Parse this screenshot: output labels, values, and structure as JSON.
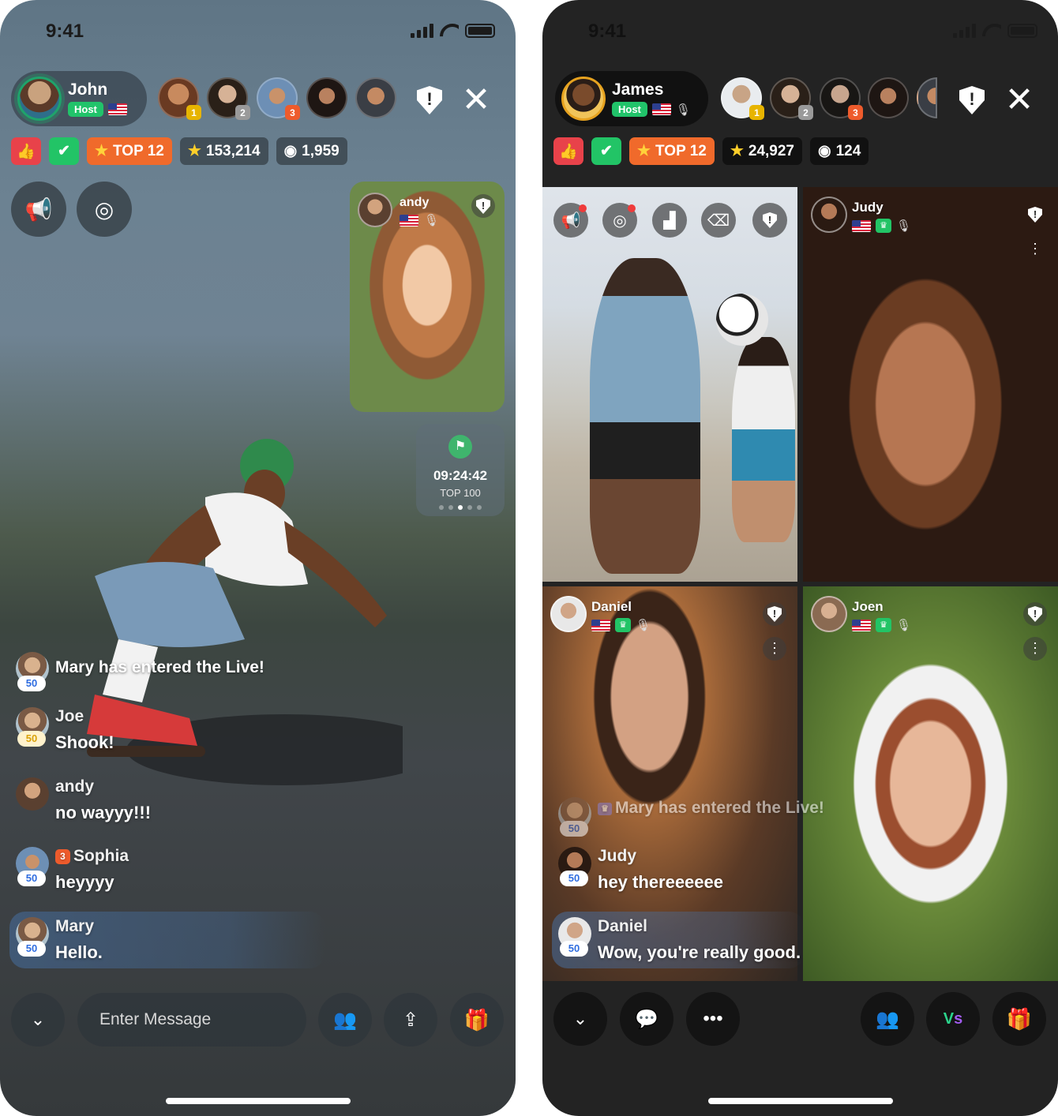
{
  "left": {
    "status": {
      "time": "9:41"
    },
    "host": {
      "name": "John",
      "badge": "Host"
    },
    "viewers": [
      {
        "rank": "1",
        "rank_class": "r1"
      },
      {
        "rank": "2",
        "rank_class": "r2"
      },
      {
        "rank": "3",
        "rank_class": "r3"
      },
      {
        "rank": ""
      },
      {
        "rank": ""
      }
    ],
    "stats": {
      "top": "TOP 12",
      "stars": "153,214",
      "views": "1,959"
    },
    "pip": {
      "name": "andy"
    },
    "timer": {
      "time": "09:24:42",
      "label": "TOP 100"
    },
    "chat": [
      {
        "name": "",
        "level": "50",
        "text": "Mary has entered the Live!"
      },
      {
        "name": "Joe",
        "level": "50",
        "text": "Shook!"
      },
      {
        "name": "andy",
        "level": "",
        "text": "no wayyy!!!"
      },
      {
        "name": "Sophia",
        "level": "50",
        "rank": "3",
        "text": "heyyyy"
      },
      {
        "name": "Mary",
        "level": "50",
        "text": "Hello."
      }
    ],
    "input": {
      "placeholder": "Enter Message"
    },
    "icons": [
      "thumbs-up-icon",
      "check-icon",
      "star-icon",
      "eye-icon",
      "megaphone-icon",
      "target-icon",
      "chevron-down-icon",
      "users-icon",
      "share-icon",
      "gift-icon",
      "shield-icon",
      "close-icon"
    ]
  },
  "right": {
    "status": {
      "time": "9:41"
    },
    "host": {
      "name": "James",
      "badge": "Host"
    },
    "viewers": [
      {
        "rank": "1",
        "rank_class": "r1"
      },
      {
        "rank": "2",
        "rank_class": "r2"
      },
      {
        "rank": "3",
        "rank_class": "r3"
      },
      {
        "rank": ""
      },
      {
        "rank": ""
      }
    ],
    "stats": {
      "top": "TOP 12",
      "stars": "24,927",
      "views": "124"
    },
    "tiles": [
      {
        "name": ""
      },
      {
        "name": "Judy"
      },
      {
        "name": "Daniel"
      },
      {
        "name": "Joen"
      }
    ],
    "chat": [
      {
        "name": "",
        "level": "50",
        "text": "Mary has entered the Live!"
      },
      {
        "name": "Judy",
        "level": "50",
        "text": "hey thereeeeee"
      },
      {
        "name": "Daniel",
        "level": "50",
        "text": "Wow, you're really good."
      }
    ],
    "icons": [
      "chevron-down-icon",
      "chat-bubble-icon",
      "more-icon",
      "users-icon",
      "versus-icon",
      "gift-icon"
    ]
  },
  "colors": {
    "accent_green": "#22c466",
    "accent_red": "#e8424a",
    "accent_orange": "#f06a2b",
    "chat_level": "#2f6de0"
  }
}
